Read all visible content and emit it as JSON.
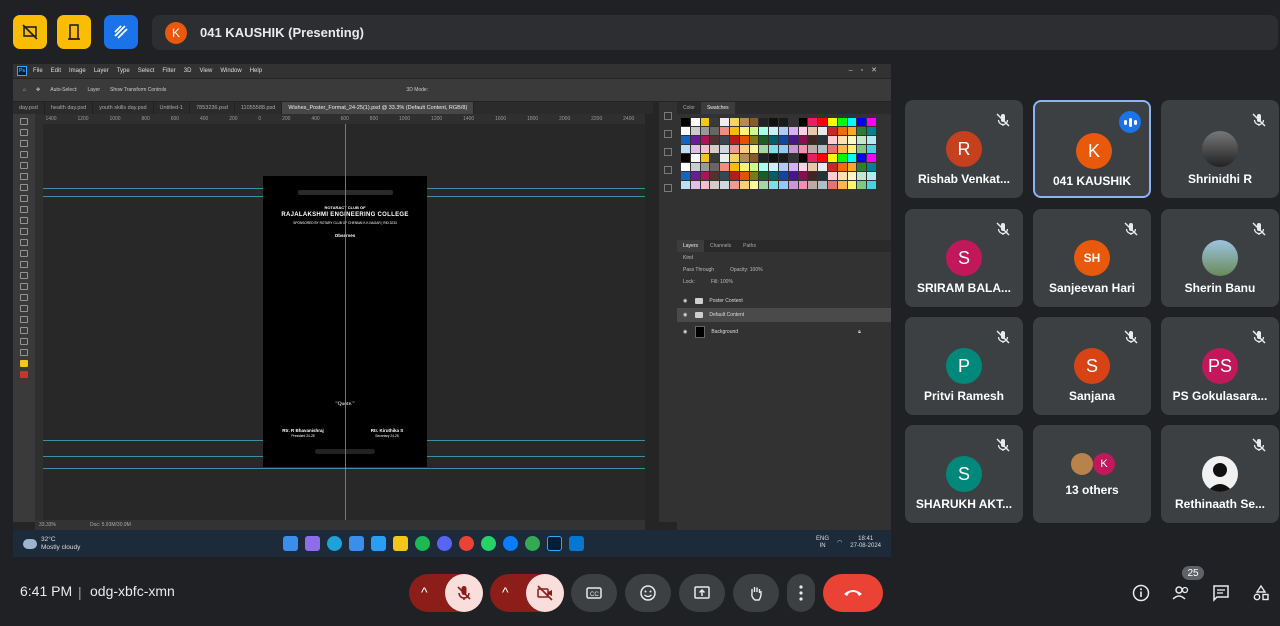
{
  "presenter_bar": {
    "avatar_letter": "K",
    "label": "041 KAUSHIK (Presenting)"
  },
  "photoshop": {
    "menu": [
      "File",
      "Edit",
      "Image",
      "Layer",
      "Type",
      "Select",
      "Filter",
      "3D",
      "View",
      "Window",
      "Help"
    ],
    "options": {
      "auto_select": "Auto-Select:",
      "layer_dropdown": "Layer",
      "transform": "Show Transform Controls",
      "mode_3d": "3D Mode:"
    },
    "tabs": [
      "day.psd",
      "health day.psd",
      "youth skills day.psd",
      "Untitled-1",
      "7853236.psd",
      "11055588.psd",
      "Wishes_Poster_Format_24-25(1).psd @ 33.3% (Default Content, RGB/8)"
    ],
    "ruler_ticks": [
      "1400",
      "1200",
      "1000",
      "800",
      "600",
      "400",
      "200",
      "0",
      "200",
      "400",
      "600",
      "800",
      "1000",
      "1200",
      "1400",
      "1600",
      "1800",
      "2000",
      "2200",
      "2400"
    ],
    "status": {
      "zoom": "33.33%",
      "doc": "Doc: 5.93M/30.9M"
    },
    "poster": {
      "club": "ROTARACT CLUB OF",
      "college": "RAJALAKSHMI ENGINEERING COLLEGE",
      "sponsor": "SPONSORED BY ROTARY CLUB OF CHENNAI K.K.NAGAR | RID 3233",
      "observes": "Observes",
      "quote": "\"Quote.\"",
      "sig1_name": "Rtr. R Bhavanishraj",
      "sig1_role": "President 24-25",
      "sig2_name": "Rtr. Kiruthika S",
      "sig2_role": "Secretary 24-25"
    },
    "panel_tabs_top": [
      "Color",
      "Swatches"
    ],
    "panel_tabs_layers": [
      "Layers",
      "Channels",
      "Paths"
    ],
    "layer_options": {
      "kind": "Kind",
      "blend": "Pass Through",
      "opacity_label": "Opacity:",
      "opacity": "100%",
      "lock": "Lock:",
      "fill_label": "Fill:",
      "fill": "100%"
    },
    "layers": [
      "Poster Content",
      "Default Content",
      "Background"
    ]
  },
  "taskbar": {
    "temp": "32°C",
    "weather": "Mostly cloudy",
    "lang1": "ENG",
    "lang2": "IN",
    "clock_time": "18:41",
    "clock_date": "27-08-2024"
  },
  "participants": [
    {
      "name": "Rishab Venkat...",
      "letter": "R",
      "color": "#c5401c"
    },
    {
      "name": "041 KAUSHIK",
      "letter": "K",
      "color": "#e8590c"
    },
    {
      "name": "Shrinidhi R",
      "letter": "",
      "color": "#555"
    },
    {
      "name": "SRIRAM BALA...",
      "letter": "S",
      "color": "#c2185b"
    },
    {
      "name": "Sanjeevan Hari",
      "letter": "SH",
      "color": "#e8590c"
    },
    {
      "name": "Sherin Banu",
      "letter": "",
      "color": "#7aa3c9"
    },
    {
      "name": "Pritvi Ramesh",
      "letter": "P",
      "color": "#00897b"
    },
    {
      "name": "Sanjana",
      "letter": "S",
      "color": "#d84315"
    },
    {
      "name": "PS Gokulasara...",
      "letter": "PS",
      "color": "#c2185b"
    },
    {
      "name": "SHARUKH AKT...",
      "letter": "S",
      "color": "#00897b"
    },
    {
      "name": "13 others",
      "letter": "K",
      "color": "#c2185b"
    },
    {
      "name": "Rethinaath Se...",
      "letter": "",
      "color": "#eee"
    }
  ],
  "bottom": {
    "time": "6:41 PM",
    "code": "odg-xbfc-xmn",
    "people_count": "25"
  },
  "colors": {
    "accent": "#8ab4f8",
    "end_call": "#ea4335",
    "tile_bg": "#3c4043"
  }
}
